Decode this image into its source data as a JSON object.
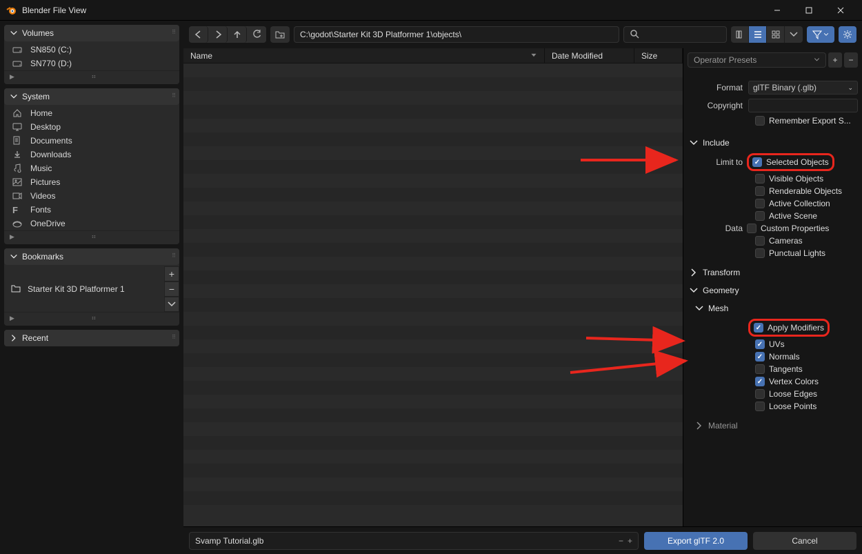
{
  "window": {
    "title": "Blender File View"
  },
  "sidebar": {
    "volumes": {
      "title": "Volumes",
      "items": [
        "SN850 (C:)",
        "SN770 (D:)"
      ]
    },
    "system": {
      "title": "System",
      "items": [
        {
          "icon": "home",
          "label": "Home"
        },
        {
          "icon": "desktop",
          "label": "Desktop"
        },
        {
          "icon": "documents",
          "label": "Documents"
        },
        {
          "icon": "downloads",
          "label": "Downloads"
        },
        {
          "icon": "music",
          "label": "Music"
        },
        {
          "icon": "pictures",
          "label": "Pictures"
        },
        {
          "icon": "videos",
          "label": "Videos"
        },
        {
          "icon": "fonts",
          "label": "Fonts"
        },
        {
          "icon": "onedrive",
          "label": "OneDrive"
        }
      ]
    },
    "bookmarks": {
      "title": "Bookmarks",
      "items": [
        "Starter Kit 3D Platformer 1"
      ]
    },
    "recent": {
      "title": "Recent"
    }
  },
  "toolbar": {
    "path": "C:\\godot\\Starter Kit 3D Platformer 1\\objects\\",
    "search_placeholder": ""
  },
  "columns": {
    "name": "Name",
    "date": "Date Modified",
    "size": "Size"
  },
  "export": {
    "presets_label": "Operator Presets",
    "format_label": "Format",
    "format_value": "glTF Binary (.glb)",
    "copyright_label": "Copyright",
    "copyright_value": "",
    "remember_label": "Remember Export S...",
    "sections": {
      "include": {
        "title": "Include",
        "limit_to_label": "Limit to",
        "options": [
          {
            "label": "Selected Objects",
            "checked": true,
            "highlight": true
          },
          {
            "label": "Visible Objects",
            "checked": false
          },
          {
            "label": "Renderable Objects",
            "checked": false
          },
          {
            "label": "Active Collection",
            "checked": false
          },
          {
            "label": "Active Scene",
            "checked": false
          }
        ],
        "data_label": "Data",
        "data_options": [
          {
            "label": "Custom Properties",
            "checked": false
          },
          {
            "label": "Cameras",
            "checked": false
          },
          {
            "label": "Punctual Lights",
            "checked": false
          }
        ]
      },
      "transform": {
        "title": "Transform"
      },
      "geometry": {
        "title": "Geometry"
      },
      "mesh": {
        "title": "Mesh",
        "options": [
          {
            "label": "Apply Modifiers",
            "checked": true,
            "highlight": true
          },
          {
            "label": "UVs",
            "checked": true
          },
          {
            "label": "Normals",
            "checked": true
          },
          {
            "label": "Tangents",
            "checked": false
          },
          {
            "label": "Vertex Colors",
            "checked": true
          },
          {
            "label": "Loose Edges",
            "checked": false
          },
          {
            "label": "Loose Points",
            "checked": false
          }
        ]
      },
      "material": {
        "title": "Material"
      }
    }
  },
  "footer": {
    "filename": "Svamp Tutorial.glb",
    "export_label": "Export glTF 2.0",
    "cancel_label": "Cancel"
  }
}
